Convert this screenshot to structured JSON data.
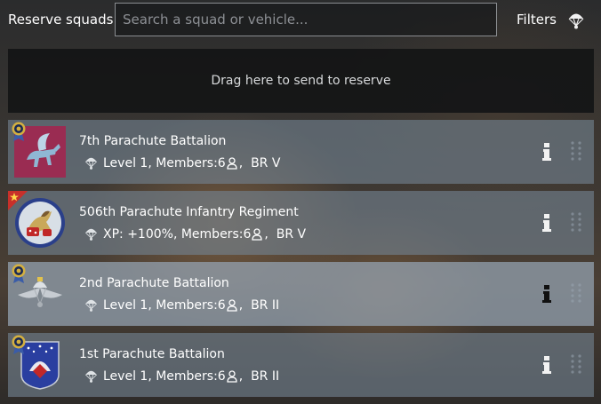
{
  "header": {
    "title": "Reserve squads",
    "search_placeholder": "Search a squad or vehicle...",
    "filters_label": "Filters"
  },
  "dropzone": {
    "label": "Drag here to send to reserve"
  },
  "squads": [
    {
      "name": "7th Parachute Battalion",
      "stat": "Level 1, Members:6",
      "br": "BR V"
    },
    {
      "name": "506th Parachute Infantry Regiment",
      "stat": "XP: +100%, Members:6",
      "br": "BR V"
    },
    {
      "name": "2nd Parachute Battalion",
      "stat": "Level 1, Members:6",
      "br": "BR II"
    },
    {
      "name": "1st Parachute Battalion",
      "stat": "Level 1, Members:6",
      "br": "BR II"
    }
  ],
  "colors": {
    "accent_gold": "#d4b040",
    "badge_red": "#c8302a",
    "panel": "#7d8996"
  },
  "icons": [
    "parachute-icon",
    "medal-badge-icon",
    "star-badge-icon",
    "member-icon",
    "info-icon",
    "drag-handle-icon"
  ]
}
